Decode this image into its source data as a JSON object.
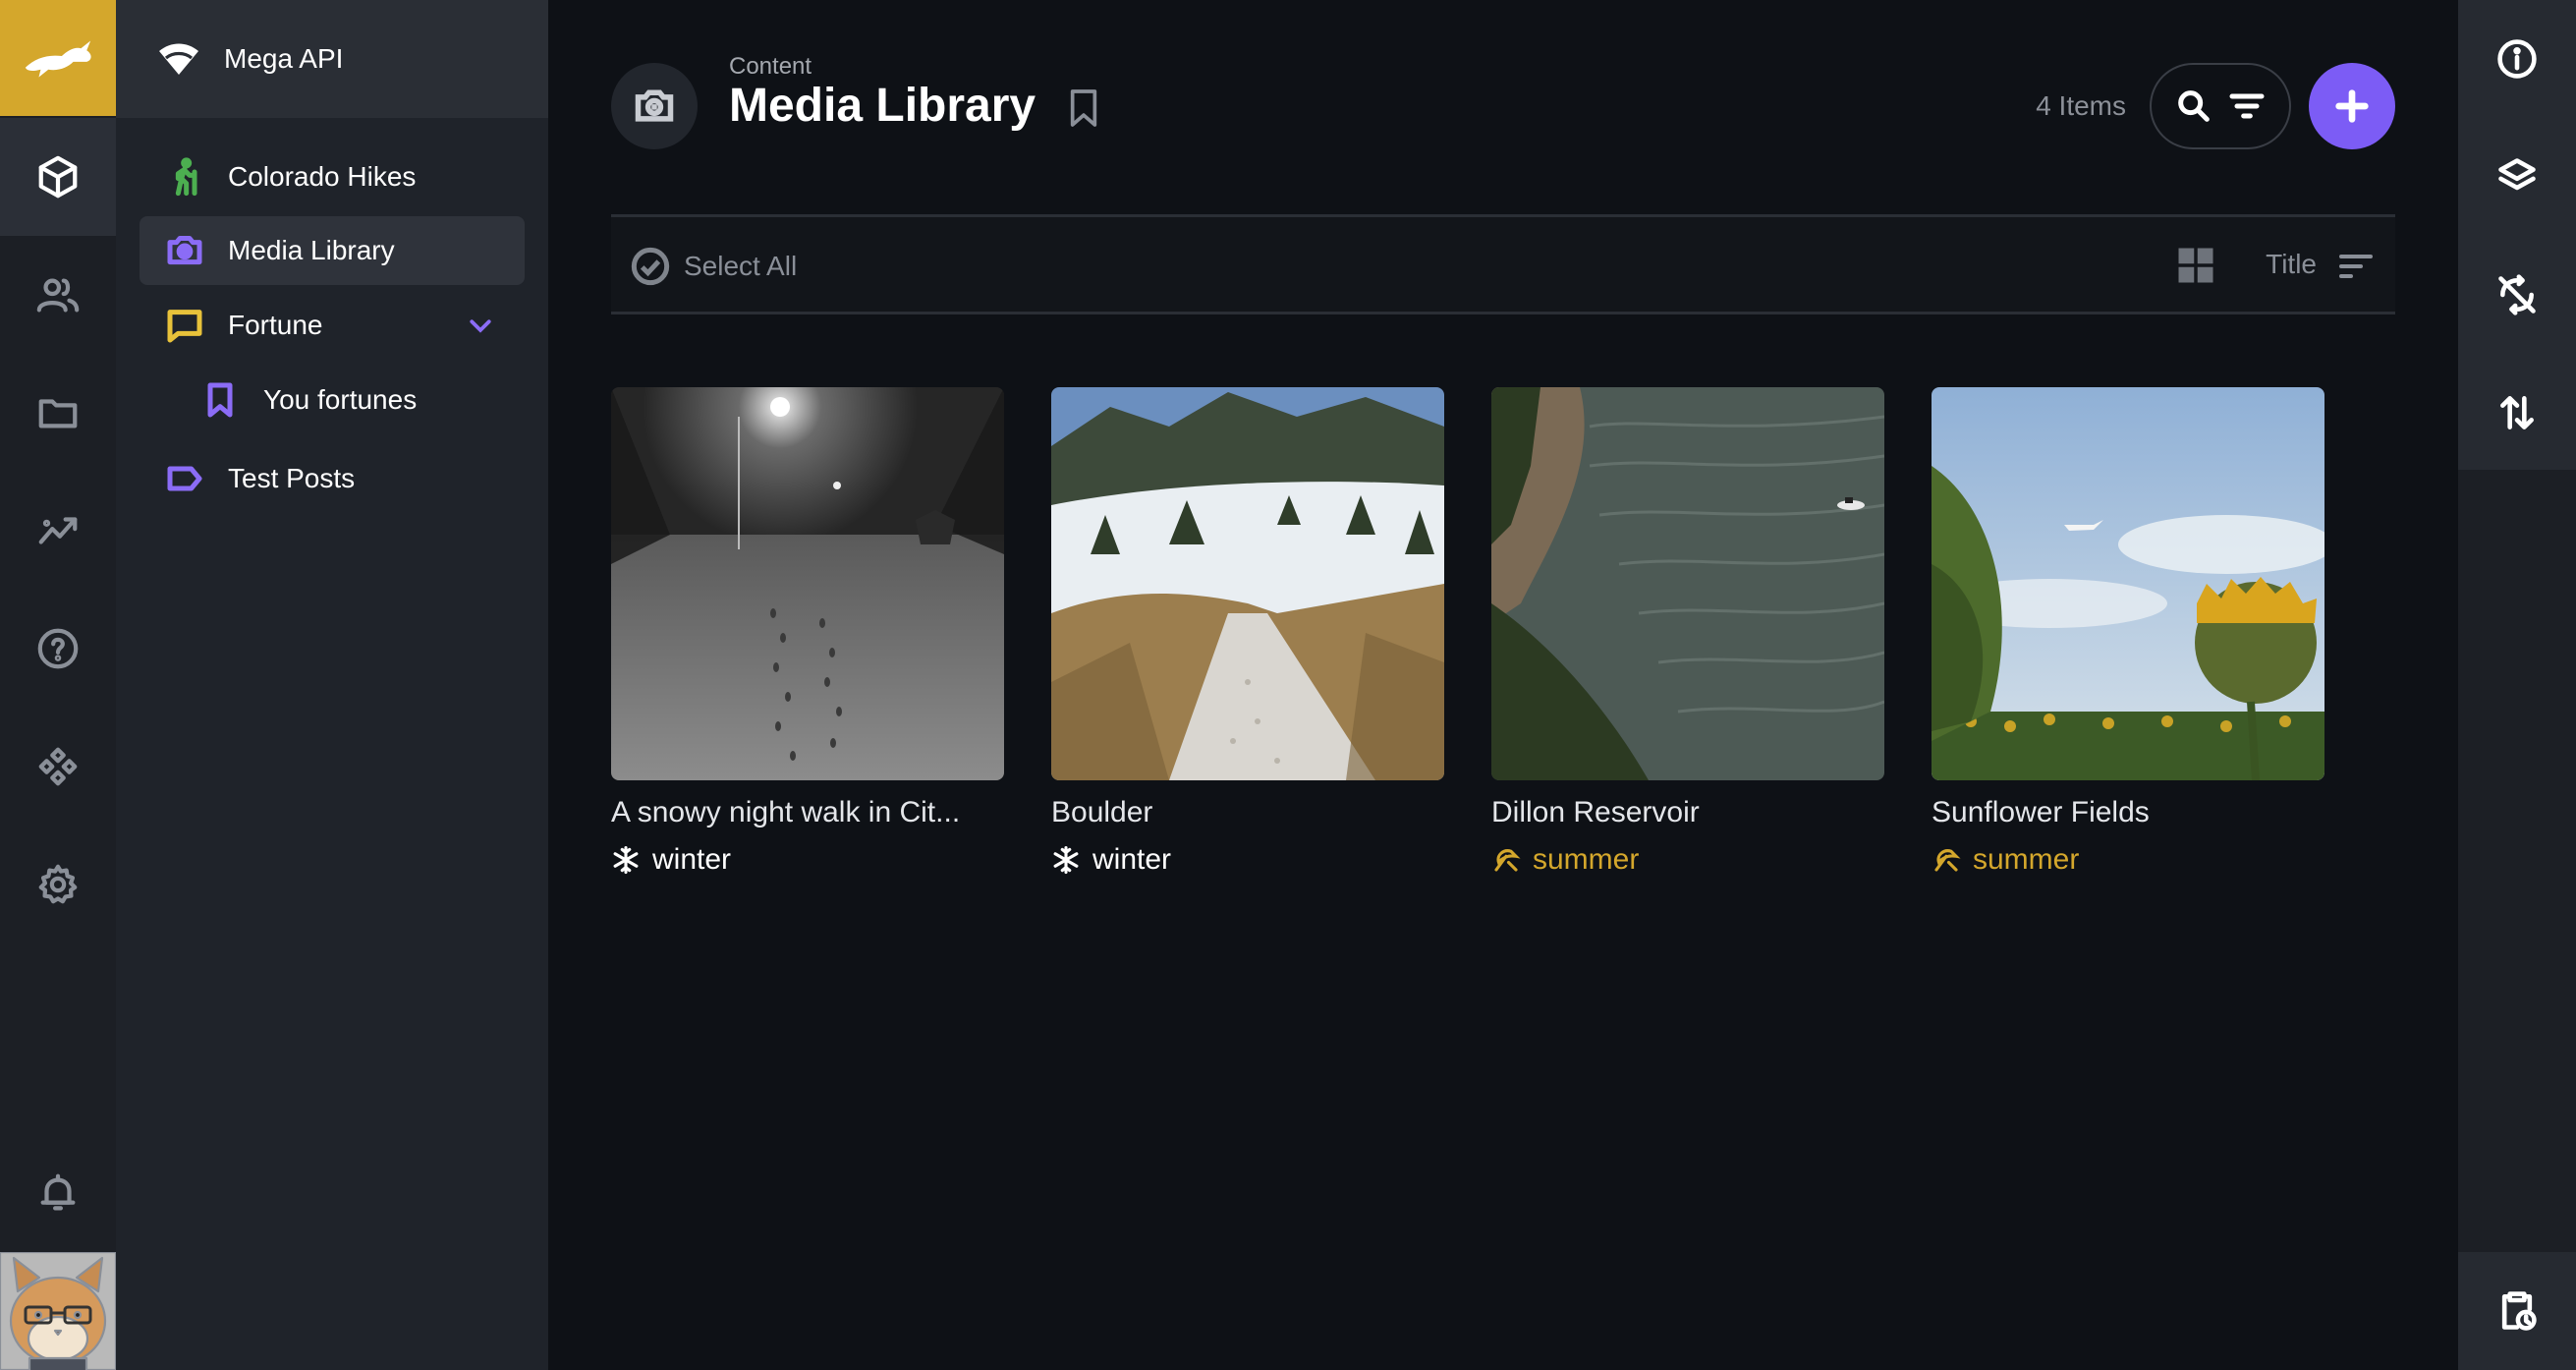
{
  "app": {
    "instance_name": "Mega API"
  },
  "rail": {
    "icons": [
      "rabbit-logo",
      "content-cube-icon",
      "users-icon",
      "folder-icon",
      "analytics-icon",
      "help-icon",
      "integrations-icon",
      "settings-icon",
      "bell-icon",
      "avatar"
    ]
  },
  "sidebar": {
    "items": [
      {
        "label": "Colorado Hikes",
        "icon": "hiker-icon",
        "color": "#4caf50"
      },
      {
        "label": "Media Library",
        "icon": "camera-icon",
        "color": "#8b6cf6",
        "active": true
      },
      {
        "label": "Fortune",
        "icon": "message-icon",
        "color": "#e8c23a",
        "expanded": true
      },
      {
        "label": "You fortunes",
        "icon": "bookmark-icon",
        "color": "#8b6cf6"
      },
      {
        "label": "Test Posts",
        "icon": "tag-icon",
        "color": "#8b6cf6"
      }
    ]
  },
  "header": {
    "breadcrumb": "Content",
    "title": "Media Library",
    "count": "4 Items"
  },
  "toolbar": {
    "select_all": "Select All",
    "sort_label": "Title"
  },
  "cards": [
    {
      "caption": "A snowy night walk in Cit...",
      "tag": "winter",
      "tag_color": "#ffffff",
      "tag_icon": "snowflake-icon"
    },
    {
      "caption": "Boulder",
      "tag": "winter",
      "tag_color": "#ffffff",
      "tag_icon": "snowflake-icon"
    },
    {
      "caption": "Dillon Reservoir",
      "tag": "summer",
      "tag_color": "#d4a72c",
      "tag_icon": "umbrella-beach-icon"
    },
    {
      "caption": "Sunflower Fields",
      "tag": "summer",
      "tag_color": "#d4a72c",
      "tag_icon": "umbrella-beach-icon"
    }
  ],
  "colors": {
    "accent": "#7c5cf5",
    "brand": "#d4a72c"
  }
}
